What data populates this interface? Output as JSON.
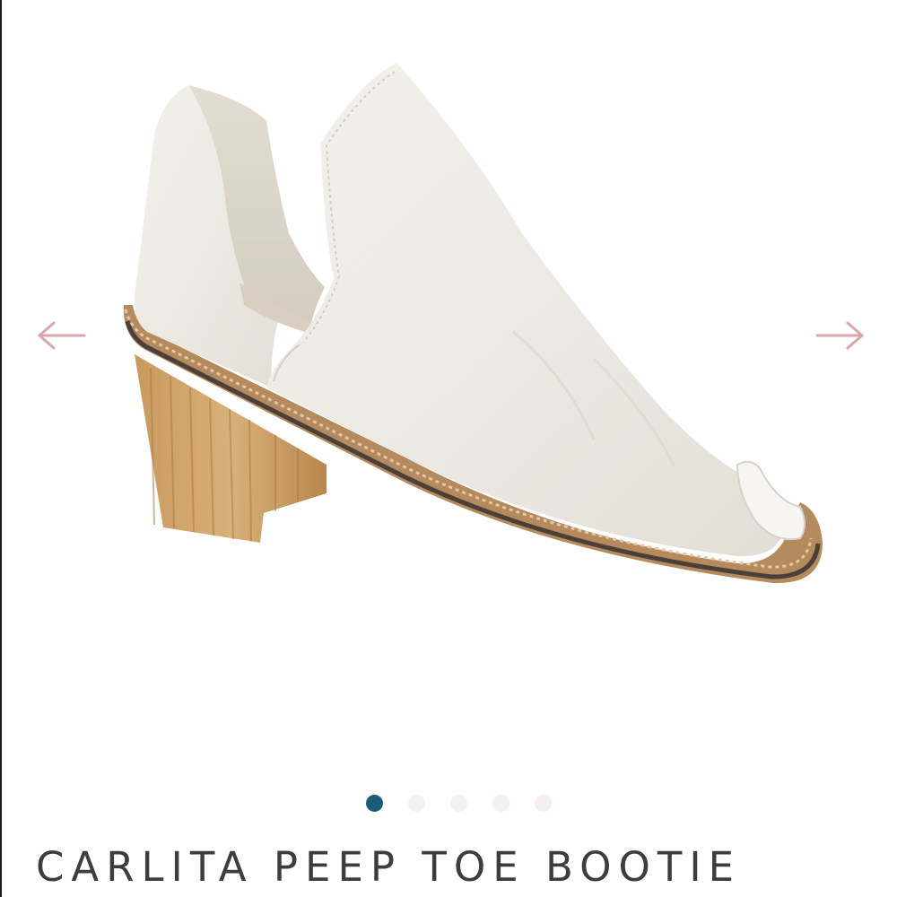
{
  "product": {
    "title": "CARLITA PEEP TOE BOOTIE",
    "image": "white leather peep toe bootie with stacked wooden block heel"
  },
  "gallery": {
    "prev_icon": "arrow-left-icon",
    "next_icon": "arrow-right-icon",
    "arrow_color": "#d9a7ac",
    "dot_count": 5,
    "active_dot": 1,
    "active_dot_color": "#1a5c77",
    "inactive_dot_color": "#f7eef1"
  }
}
